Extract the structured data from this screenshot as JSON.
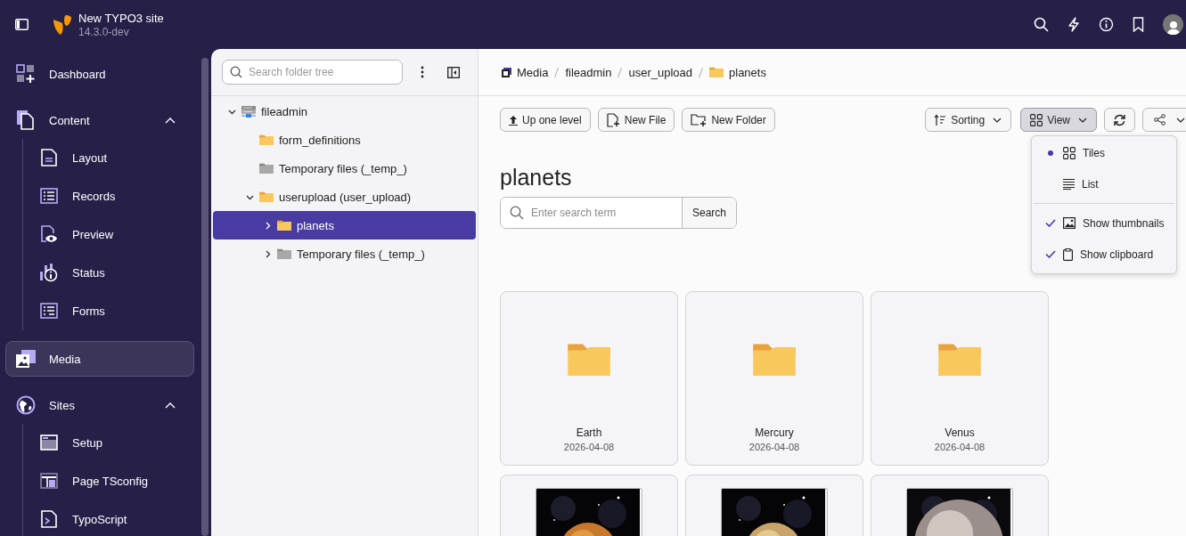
{
  "app": {
    "title": "New TYPO3 site",
    "version": "14.3.0-dev"
  },
  "sidebar": {
    "items": [
      {
        "label": "Dashboard",
        "selected": false
      },
      {
        "label": "Content",
        "selected": false,
        "expanded": true,
        "children": [
          {
            "label": "Layout",
            "selected": false
          },
          {
            "label": "Records",
            "selected": false
          },
          {
            "label": "Preview",
            "selected": false
          },
          {
            "label": "Status",
            "selected": false
          },
          {
            "label": "Forms",
            "selected": false
          }
        ]
      },
      {
        "label": "Media",
        "selected": true
      },
      {
        "label": "Sites",
        "selected": false,
        "expanded": true,
        "children": [
          {
            "label": "Setup",
            "selected": false
          },
          {
            "label": "Page TSconfig",
            "selected": false
          },
          {
            "label": "TypoScript",
            "selected": false
          }
        ]
      }
    ]
  },
  "folder_tree": {
    "search": {
      "placeholder": "Search folder tree"
    },
    "items": [
      {
        "label": "fileadmin",
        "kind": "storage",
        "selected": false,
        "expanded": true,
        "children": [
          {
            "label": "form_definitions",
            "kind": "folder",
            "selected": false
          },
          {
            "label": "Temporary files (_temp_)",
            "kind": "temp",
            "selected": false
          },
          {
            "label": "userupload (user_upload)",
            "kind": "folder",
            "selected": false,
            "expanded": true,
            "children": [
              {
                "label": "planets",
                "kind": "folder",
                "selected": true,
                "expanded": false
              },
              {
                "label": "Temporary files (_temp_)",
                "kind": "temp",
                "selected": false,
                "expanded": false
              }
            ]
          }
        ]
      }
    ]
  },
  "breadcrumb": [
    "Media",
    "fileadmin",
    "user_upload",
    "planets"
  ],
  "toolbar": {
    "buttons": [
      "Up one level",
      "New File",
      "New Folder"
    ],
    "sorting": "Sorting",
    "view": {
      "label": "View",
      "open": true
    }
  },
  "view_menu": [
    {
      "kind": "radio",
      "label": "Tiles",
      "selected": true
    },
    {
      "kind": "radio",
      "label": "List",
      "selected": false
    },
    {
      "kind": "check",
      "label": "Show thumbnails",
      "checked": true
    },
    {
      "kind": "check",
      "label": "Show clipboard",
      "checked": true
    }
  ],
  "heading": "planets",
  "search": {
    "placeholder": "Enter search term",
    "button": "Search"
  },
  "tiles": [
    {
      "kind": "folder",
      "name": "Earth",
      "date": "2026-04-08"
    },
    {
      "kind": "folder",
      "name": "Mercury",
      "date": "2026-04-08"
    },
    {
      "kind": "folder",
      "name": "Venus",
      "date": "2026-04-08"
    },
    {
      "kind": "picture"
    },
    {
      "kind": "picture"
    },
    {
      "kind": "picture"
    }
  ]
}
